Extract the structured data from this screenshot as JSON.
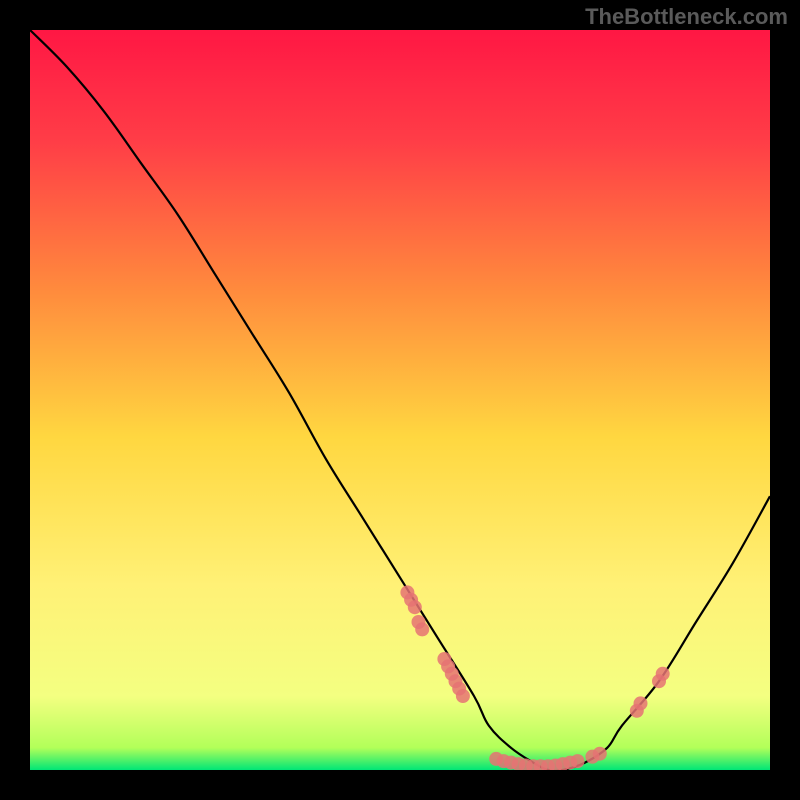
{
  "watermark": "TheBottleneck.com",
  "chart_data": {
    "type": "line",
    "title": "",
    "xlabel": "",
    "ylabel": "",
    "xlim": [
      0,
      100
    ],
    "ylim": [
      0,
      100
    ],
    "gradient_stops": [
      {
        "offset": 0,
        "color": "#ff1744"
      },
      {
        "offset": 15,
        "color": "#ff3d47"
      },
      {
        "offset": 35,
        "color": "#ff8a3d"
      },
      {
        "offset": 55,
        "color": "#ffd740"
      },
      {
        "offset": 75,
        "color": "#fff176"
      },
      {
        "offset": 90,
        "color": "#f4ff81"
      },
      {
        "offset": 97,
        "color": "#b2ff59"
      },
      {
        "offset": 100,
        "color": "#00e676"
      }
    ],
    "series": [
      {
        "name": "curve",
        "type": "line",
        "color": "#000000",
        "x": [
          0,
          5,
          10,
          15,
          20,
          25,
          30,
          35,
          40,
          45,
          50,
          55,
          60,
          62,
          65,
          68,
          70,
          72,
          75,
          78,
          80,
          85,
          90,
          95,
          100
        ],
        "y": [
          100,
          95,
          89,
          82,
          75,
          67,
          59,
          51,
          42,
          34,
          26,
          18,
          10,
          6,
          3,
          1,
          0,
          0,
          1,
          3,
          6,
          12,
          20,
          28,
          37
        ]
      },
      {
        "name": "points-left-cluster",
        "type": "scatter",
        "color": "#e57373",
        "x": [
          51,
          51.5,
          52,
          52.5,
          53
        ],
        "y": [
          24,
          23,
          22,
          20,
          19
        ]
      },
      {
        "name": "points-mid-cluster",
        "type": "scatter",
        "color": "#e57373",
        "x": [
          56,
          56.5,
          57,
          57.5,
          58,
          58.5
        ],
        "y": [
          15,
          14,
          13,
          12,
          11,
          10
        ]
      },
      {
        "name": "points-bottom-row",
        "type": "scatter",
        "color": "#e57373",
        "x": [
          63,
          64,
          65,
          66,
          67,
          68,
          69,
          70,
          71,
          72,
          73,
          74,
          76,
          77
        ],
        "y": [
          1.5,
          1.2,
          1,
          0.8,
          0.6,
          0.5,
          0.5,
          0.5,
          0.6,
          0.8,
          1,
          1.2,
          1.8,
          2.2
        ]
      },
      {
        "name": "points-right-cluster",
        "type": "scatter",
        "color": "#e57373",
        "x": [
          82,
          82.5,
          85,
          85.5
        ],
        "y": [
          8,
          9,
          12,
          13
        ]
      }
    ]
  }
}
